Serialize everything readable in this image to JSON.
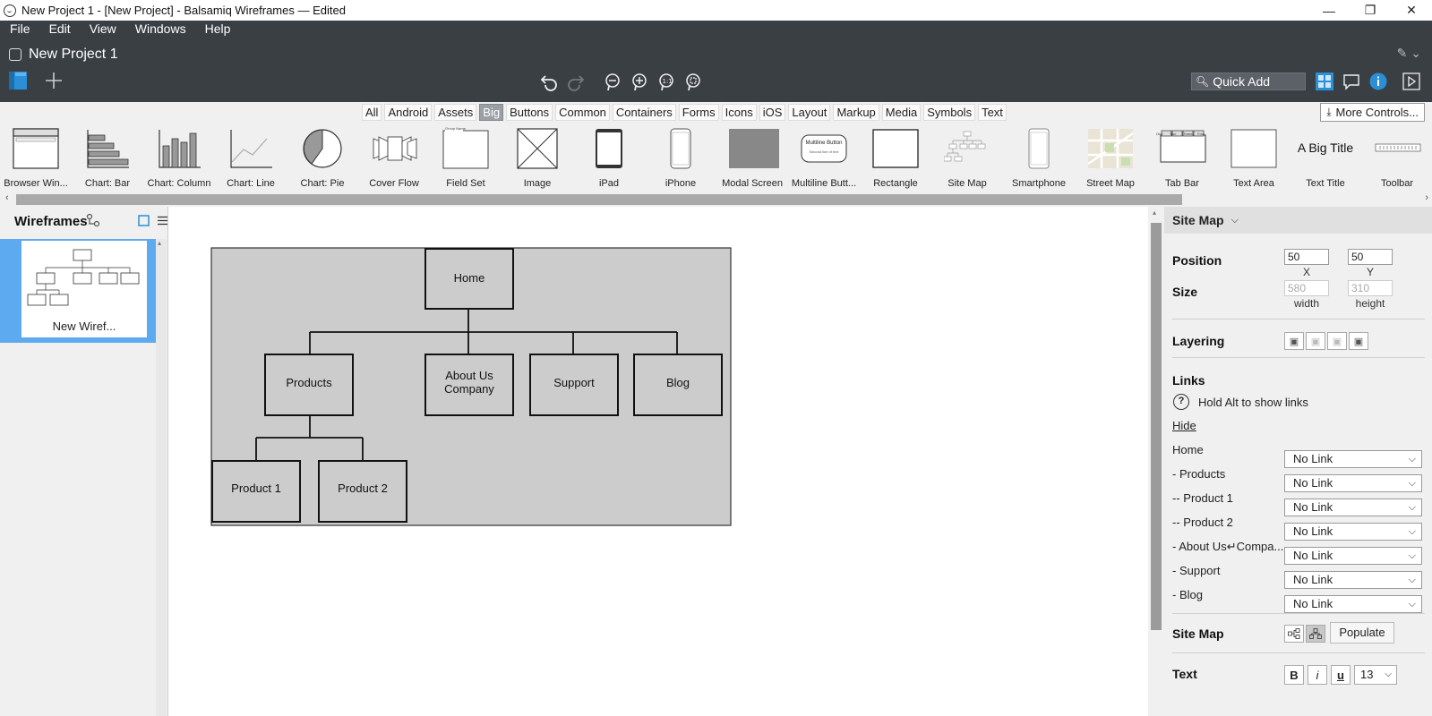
{
  "window": {
    "title": "New Project 1 - [New Project] - Balsamiq Wireframes — Edited",
    "minimize": "—",
    "maximize": "❐",
    "close": "✕"
  },
  "menu": [
    "File",
    "Edit",
    "View",
    "Windows",
    "Help"
  ],
  "project": {
    "name": "New Project 1"
  },
  "toolbar": {
    "quick_add_placeholder": "Quick Add"
  },
  "categories": [
    "All",
    "Android",
    "Assets",
    "Big",
    "Buttons",
    "Common",
    "Containers",
    "Forms",
    "Icons",
    "iOS",
    "Layout",
    "Markup",
    "Media",
    "Symbols",
    "Text"
  ],
  "active_category": "Big",
  "more_controls": "More Controls...",
  "gallery": [
    {
      "label": "Browser Win...",
      "icon": "browser-window-icon"
    },
    {
      "label": "Chart: Bar",
      "icon": "chart-bar-icon"
    },
    {
      "label": "Chart: Column",
      "icon": "chart-column-icon"
    },
    {
      "label": "Chart: Line",
      "icon": "chart-line-icon"
    },
    {
      "label": "Chart: Pie",
      "icon": "chart-pie-icon"
    },
    {
      "label": "Cover Flow",
      "icon": "cover-flow-icon"
    },
    {
      "label": "Field Set",
      "icon": "field-set-icon",
      "thumb_text": "Group Name"
    },
    {
      "label": "Image",
      "icon": "image-placeholder-icon"
    },
    {
      "label": "iPad",
      "icon": "ipad-icon"
    },
    {
      "label": "iPhone",
      "icon": "iphone-icon"
    },
    {
      "label": "Modal Screen",
      "icon": "modal-screen-icon"
    },
    {
      "label": "Multiline Butt...",
      "icon": "multiline-button-icon",
      "thumb_line1": "Multiline Button",
      "thumb_line2": "Second line of text"
    },
    {
      "label": "Rectangle",
      "icon": "rectangle-icon"
    },
    {
      "label": "Site Map",
      "icon": "site-map-icon"
    },
    {
      "label": "Smartphone",
      "icon": "smartphone-icon"
    },
    {
      "label": "Street Map",
      "icon": "street-map-icon"
    },
    {
      "label": "Tab Bar",
      "icon": "tab-bar-icon",
      "thumb_tabs": [
        "One",
        "Two",
        "Three",
        "Four"
      ]
    },
    {
      "label": "Text Area",
      "icon": "text-area-icon"
    },
    {
      "label": "Text Title",
      "icon": "text-title-icon",
      "thumb_text": "A Big Title"
    },
    {
      "label": "Toolbar",
      "icon": "toolbar-icon"
    }
  ],
  "left_panel": {
    "title": "Wireframes",
    "selected_wireframe": "New Wiref..."
  },
  "sitemap": {
    "home": "Home",
    "level1": [
      "Products",
      "About Us\nCompany",
      "Support",
      "Blog"
    ],
    "level2": [
      "Product 1",
      "Product 2"
    ]
  },
  "inspector": {
    "title": "Site Map",
    "position_label": "Position",
    "x": "50",
    "y": "50",
    "x_label": "X",
    "y_label": "Y",
    "size_label": "Size",
    "width": "580",
    "height": "310",
    "width_label": "width",
    "height_label": "height",
    "layering_label": "Layering",
    "links_label": "Links",
    "links_hint": "Hold Alt to show links",
    "hide_link": "Hide",
    "link_rows": [
      {
        "label": "Home",
        "value": "No Link"
      },
      {
        "label": "- Products",
        "value": "No Link"
      },
      {
        "label": "-- Product 1",
        "value": "No Link"
      },
      {
        "label": "-- Product 2",
        "value": "No Link"
      },
      {
        "label": "- About Us↵Compa...",
        "value": "No Link"
      },
      {
        "label": "- Support",
        "value": "No Link"
      },
      {
        "label": "- Blog",
        "value": "No Link"
      }
    ],
    "sitemap_label": "Site Map",
    "populate": "Populate",
    "text_label": "Text",
    "bold": "B",
    "italic": "i",
    "underline": "u",
    "font_size": "13"
  },
  "colors": {
    "header_bg": "#3a3f44",
    "selection_blue": "#5eaaf0",
    "canvas_group_fill": "#cccccc",
    "accent_blue": "#2b8fd6"
  }
}
